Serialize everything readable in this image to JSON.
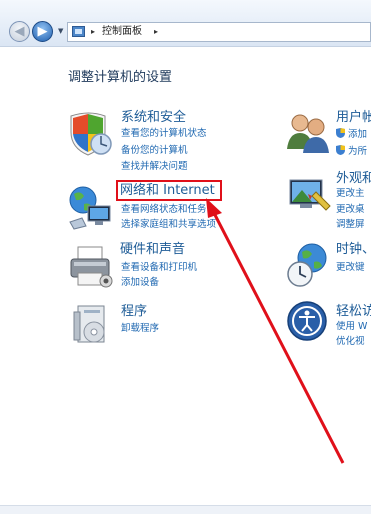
{
  "address_bar": {
    "breadcrumb": "控制面板",
    "separator": "▸"
  },
  "page": {
    "title": "调整计算机的设置"
  },
  "categories": [
    {
      "title": "系统和安全",
      "links": [
        "查看您的计算机状态",
        "备份您的计算机",
        "查找并解决问题"
      ]
    },
    {
      "title": "网络和 Internet",
      "links": [
        "查看网络状态和任务",
        "选择家庭组和共享选项"
      ]
    },
    {
      "title": "硬件和声音",
      "links": [
        "查看设备和打印机",
        "添加设备"
      ]
    },
    {
      "title": "程序",
      "links": [
        "卸载程序"
      ]
    },
    {
      "title": "用户帐",
      "links": [
        "添加",
        "为所"
      ]
    },
    {
      "title": "外观和",
      "links": [
        "更改主",
        "更改桌",
        "调整屏"
      ]
    },
    {
      "title": "时钟、",
      "links": [
        "更改键",
        ""
      ]
    },
    {
      "title": "轻松访",
      "links": [
        "使用 W",
        "优化视"
      ]
    }
  ],
  "annotation": {
    "highlight_color": "#e0101a"
  },
  "colors": {
    "link": "#1f68b1",
    "title": "#1e5c97",
    "heading": "#1e395b"
  }
}
